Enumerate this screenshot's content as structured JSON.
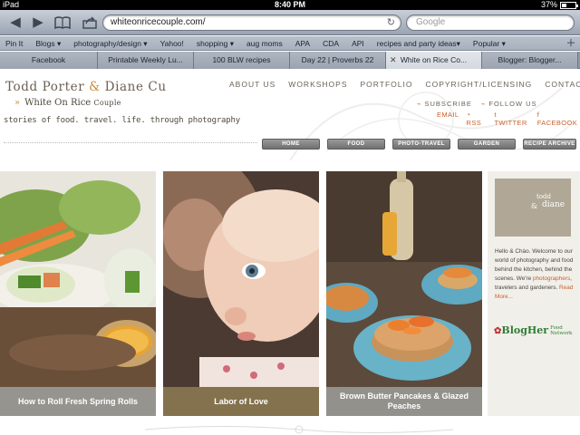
{
  "status": {
    "device": "iPad",
    "time": "8:40 PM",
    "battery": "37%"
  },
  "browser": {
    "url": "whiteonricecouple.com/",
    "search_placeholder": "Google",
    "bookmarks": [
      "Pin It",
      "Blogs ▾",
      "photography/design ▾",
      "Yahoo!",
      "shopping ▾",
      "aug moms",
      "APA",
      "CDA",
      "API",
      "recipes and party ideas▾",
      "Popular ▾"
    ],
    "tabs": [
      {
        "label": "Facebook",
        "active": false
      },
      {
        "label": "Printable Weekly Lu...",
        "active": false
      },
      {
        "label": "100 BLW recipes",
        "active": false
      },
      {
        "label": "Day 22 | Proverbs 22",
        "active": false
      },
      {
        "label": "White on Rice Co...",
        "active": true
      },
      {
        "label": "Blogger: Blogger...",
        "active": false
      }
    ]
  },
  "site": {
    "title_a": "Todd Porter ",
    "title_amp": "&",
    "title_b": " Diane Cu",
    "brand_prefix": "White On Rice ",
    "brand_suffix": "Couple",
    "tagline": "stories of food. travel. life. through photography",
    "topnav": [
      "ABOUT US",
      "WORKSHOPS",
      "PORTFOLIO",
      "COPYRIGHT/LICENSING",
      "CONTACT"
    ],
    "subscribe": "SUBSCRIBE",
    "follow": "FOLLOW US",
    "links": [
      "EMAIL",
      "RSS",
      "TWITTER",
      "FACEBOOK"
    ],
    "catnav": [
      "HOME",
      "FOOD",
      "PHOTO-TRAVEL",
      "GARDEN",
      "RECIPE ARCHIVE"
    ]
  },
  "posts": [
    {
      "title": "How to Roll Fresh Spring Rolls"
    },
    {
      "title": "Labor of Love"
    },
    {
      "title": "Brown Butter Pancakes & Glazed Peaches"
    }
  ],
  "sidebar": {
    "logo_line1": "todd",
    "logo_amp": "&",
    "logo_line2": "diane",
    "bio_a": "Hello & Chào. Welcome to our world of photography and food behind the kitchen, behind the scenes. We're ",
    "bio_link": "photographers",
    "bio_b": ", travelers and gardeners. ",
    "bio_more": "Read More...",
    "blogher": "BlogHer",
    "blogher_sub1": "Food",
    "blogher_sub2": "Network"
  },
  "colors": {
    "accent": "#c98a3a",
    "link": "#c9612b",
    "caption_gray": "#8a8882",
    "caption_brown": "#7d6a45"
  }
}
